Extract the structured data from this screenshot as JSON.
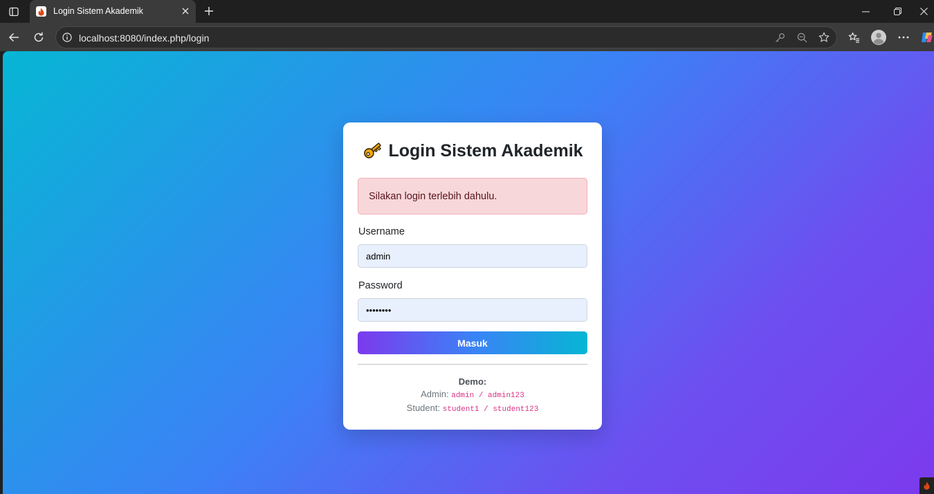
{
  "browser": {
    "tab_title": "Login Sistem Akademik",
    "url": "localhost:8080/index.php/login"
  },
  "login": {
    "title": "Login Sistem Akademik",
    "alert": "Silakan login terlebih dahulu.",
    "username_label": "Username",
    "username_value": "admin",
    "password_label": "Password",
    "password_value": "admin123",
    "submit_label": "Masuk"
  },
  "demo": {
    "heading": "Demo:",
    "admin_label": "Admin:",
    "admin_credentials": "admin / admin123",
    "student_label": "Student:",
    "student_credentials": "student1 / student123"
  },
  "colors": {
    "gradient_start": "#06b6d4",
    "gradient_end": "#7c3aed",
    "alert_bg": "#f8d7da",
    "code_color": "#d63384"
  },
  "icons": [
    "sidebar-toggle-icon",
    "flame-icon",
    "close-icon",
    "plus-icon",
    "minimize-icon",
    "restore-icon",
    "back-arrow-icon",
    "reload-icon",
    "info-icon",
    "key-icon",
    "zoom-out-icon",
    "star-icon",
    "favorites-icon",
    "profile-icon",
    "more-icon",
    "copilot-icon"
  ]
}
